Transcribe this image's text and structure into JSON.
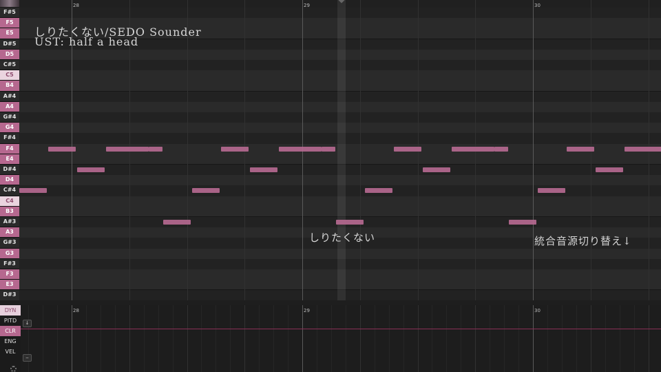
{
  "piano_roll": {
    "keys": [
      "F#5",
      "F5",
      "E5",
      "D#5",
      "D5",
      "C#5",
      "C5",
      "B4",
      "A#4",
      "A4",
      "G#4",
      "G4",
      "F#4",
      "F4",
      "E4",
      "D#4",
      "D4",
      "C#4",
      "C4",
      "B3",
      "A#3",
      "A3",
      "G#3",
      "G3",
      "F#3",
      "F3",
      "E3",
      "D#3"
    ],
    "bar_numbers": [
      "28",
      "29",
      "30"
    ]
  },
  "overlay": {
    "title": "しりたくない/SEDO Sounder",
    "ust": "UST: half a head",
    "lyric_mid": "しりたくない",
    "lyric_right": "統合音源切り替え↓"
  },
  "params": {
    "labels": [
      "DYN",
      "PITD",
      "CLR",
      "ENG",
      "VEL"
    ],
    "bar_numbers": [
      "28",
      "29",
      "30"
    ],
    "button_down": "↓",
    "button_minus": "‒"
  }
}
